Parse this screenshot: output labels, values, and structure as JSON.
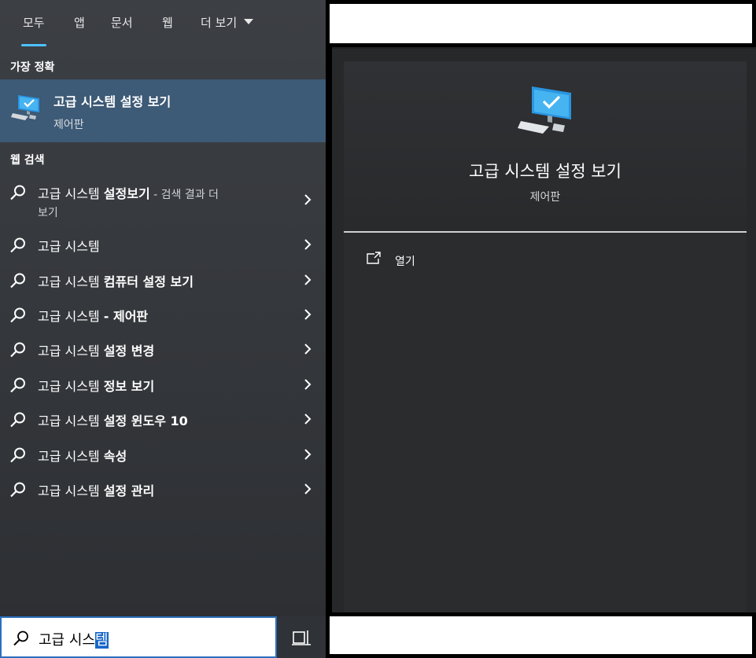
{
  "tabs": [
    {
      "label": "모두",
      "active": true
    },
    {
      "label": "앱"
    },
    {
      "label": "문서"
    },
    {
      "label": "웹"
    },
    {
      "label": "더 보기"
    }
  ],
  "best_match": {
    "heading": "가장 정확",
    "title": "고급 시스템 설정 보기",
    "subtitle": "제어판",
    "icon": "computer-monitor-check-icon"
  },
  "web_search": {
    "heading": "웹 검색",
    "items": [
      {
        "prefix": "고급 시스템 ",
        "bold": "설정보기",
        "suffix": " - 검색 결과 더",
        "line2": "보기"
      },
      {
        "prefix": "고급 시스템",
        "bold": "",
        "suffix": ""
      },
      {
        "prefix": "고급 시스템 ",
        "bold": "컴퓨터 설정 보기",
        "suffix": ""
      },
      {
        "prefix": "고급 시스템 ",
        "bold": "- 제어판",
        "suffix": ""
      },
      {
        "prefix": "고급 시스템 ",
        "bold": "설정 변경",
        "suffix": ""
      },
      {
        "prefix": "고급 시스템 ",
        "bold": "정보 보기",
        "suffix": ""
      },
      {
        "prefix": "고급 시스템 ",
        "bold": "설정 윈도우 10",
        "suffix": ""
      },
      {
        "prefix": "고급 시스템 ",
        "bold": "속성",
        "suffix": ""
      },
      {
        "prefix": "고급 시스템 ",
        "bold": "설정 관리",
        "suffix": ""
      }
    ]
  },
  "detail": {
    "title": "고급 시스템 설정 보기",
    "subtitle": "제어판",
    "actions": [
      {
        "label": "열기",
        "icon": "open-external-icon"
      }
    ]
  },
  "search": {
    "typed": "고급 시스",
    "selected": "템"
  },
  "colors": {
    "accent": "#4cc2ff",
    "best_match_bg": "#3d5a76",
    "selection": "#1766c9"
  }
}
